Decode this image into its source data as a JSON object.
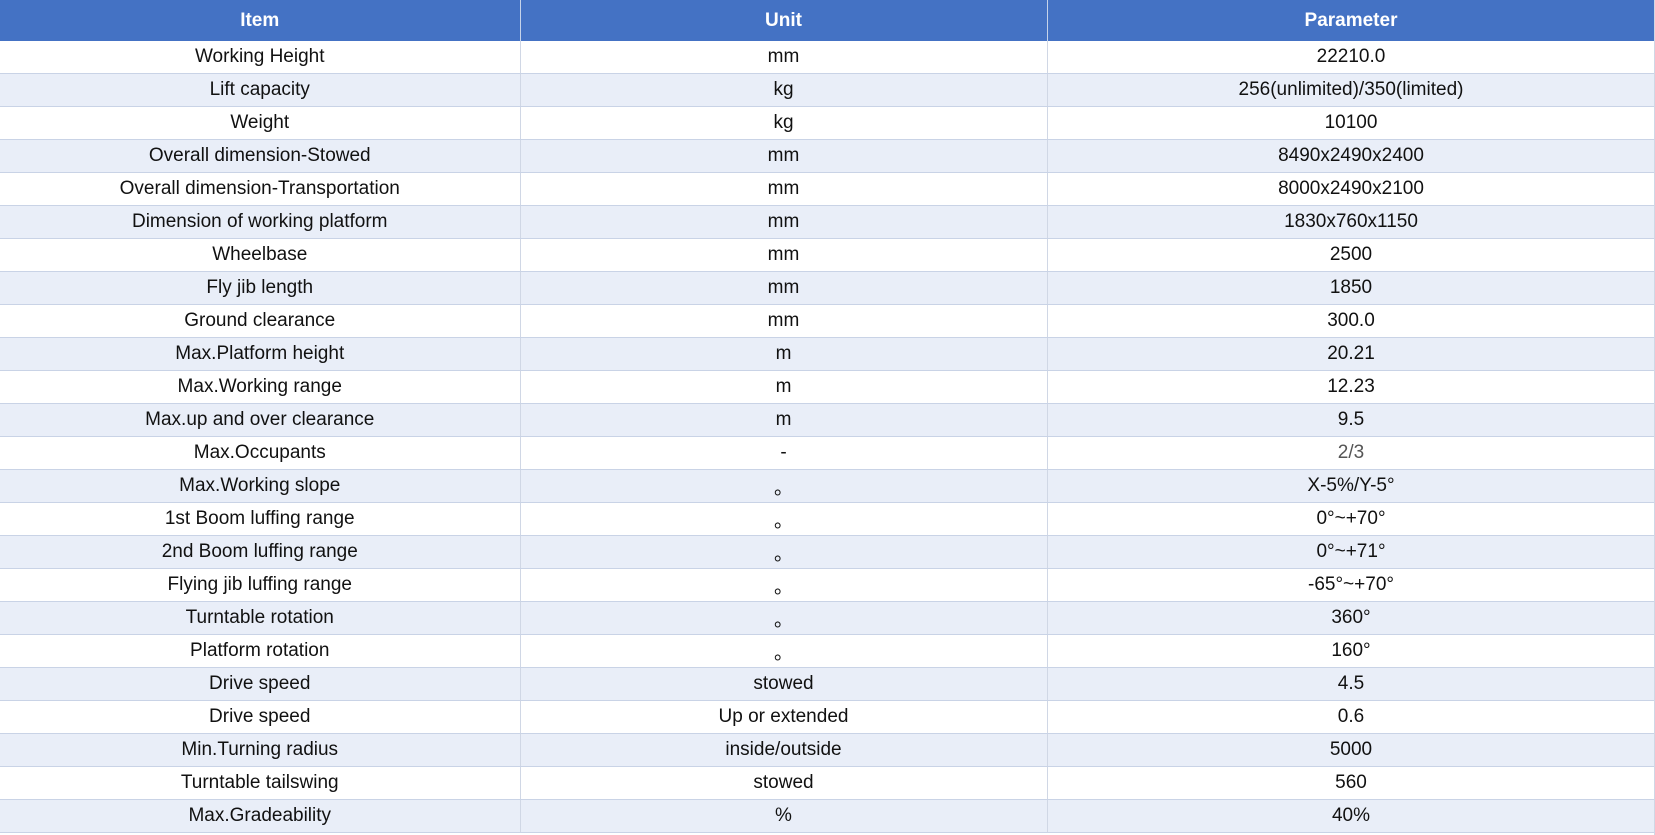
{
  "table": {
    "headers": [
      "Item",
      "Unit",
      "Parameter"
    ],
    "rows": [
      [
        "Working Height",
        "mm",
        "22210.0"
      ],
      [
        "Lift capacity",
        "kg",
        "256(unlimited)/350(limited)"
      ],
      [
        "Weight",
        "kg",
        "10100"
      ],
      [
        "Overall dimension-Stowed",
        "mm",
        "8490x2490x2400"
      ],
      [
        "Overall dimension-Transportation",
        "mm",
        "8000x2490x2100"
      ],
      [
        "Dimension of working platform",
        "mm",
        "1830x760x1150"
      ],
      [
        "Wheelbase",
        "mm",
        "2500"
      ],
      [
        "Fly jib length",
        "mm",
        "1850"
      ],
      [
        "Ground clearance",
        "mm",
        "300.0"
      ],
      [
        "Max.Platform height",
        "m",
        "20.21"
      ],
      [
        "Max.Working range",
        "m",
        "12.23"
      ],
      [
        "Max.up and over clearance",
        "m",
        "9.5"
      ],
      [
        "Max.Occupants",
        "-",
        "2/3"
      ],
      [
        "Max.Working slope",
        "。",
        "X-5%/Y-5°"
      ],
      [
        "1st Boom luffing range",
        "。",
        "0°~+70°"
      ],
      [
        "2nd Boom luffing range",
        "。",
        "0°~+71°"
      ],
      [
        "Flying jib luffing range",
        "。",
        "-65°~+70°"
      ],
      [
        "Turntable rotation",
        "。",
        "360°"
      ],
      [
        "Platform rotation",
        "。",
        "160°"
      ],
      [
        "Drive speed",
        "stowed",
        "4.5"
      ],
      [
        "Drive speed",
        "Up or extended",
        "0.6"
      ],
      [
        "Min.Turning radius",
        "inside/outside",
        "5000"
      ],
      [
        "Turntable tailswing",
        "stowed",
        "560"
      ],
      [
        "Max.Gradeability",
        "%",
        "40%"
      ]
    ]
  },
  "colors": {
    "header_bg": "#4472c4",
    "header_text": "#ffffff",
    "band_even": "#e9eef8",
    "band_odd": "#ffffff"
  }
}
